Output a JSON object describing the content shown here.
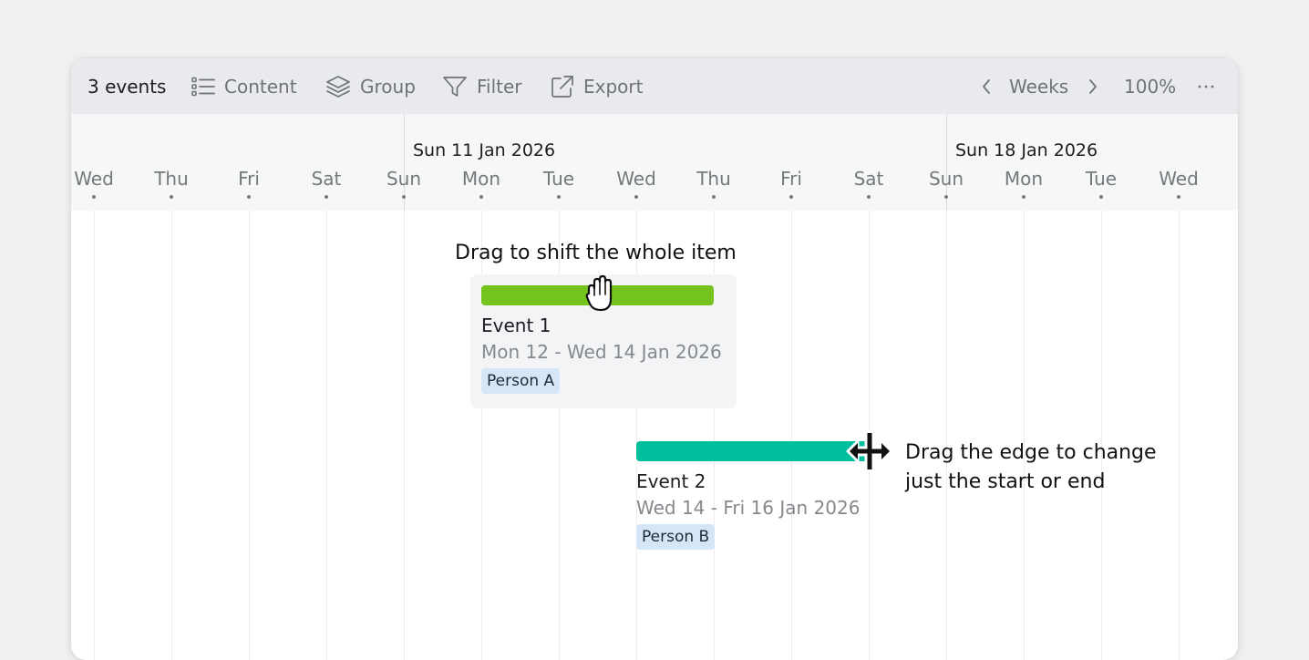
{
  "toolbar": {
    "event_count": "3 events",
    "content_label": "Content",
    "group_label": "Group",
    "filter_label": "Filter",
    "export_label": "Export",
    "scale_label": "Weeks",
    "zoom_label": "100%"
  },
  "timeline": {
    "week_labels": [
      "Sun 11 Jan 2026",
      "Sun 18 Jan 2026"
    ],
    "days": [
      "Wed",
      "Thu",
      "Fri",
      "Sat",
      "Sun",
      "Mon",
      "Tue",
      "Wed",
      "Thu",
      "Fri",
      "Sat",
      "Sun",
      "Mon",
      "Tue",
      "Wed"
    ]
  },
  "events": [
    {
      "title": "Event 1",
      "dates": "Mon 12 - Wed 14 Jan 2026",
      "person": "Person A",
      "color": "#74c41d"
    },
    {
      "title": "Event 2",
      "dates": "Wed 14 - Fri 16 Jan 2026",
      "person": "Person B",
      "color": "#00bf9c"
    }
  ],
  "hints": {
    "move": "Drag to shift the whole item",
    "resize_line1": "Drag the edge to change",
    "resize_line2": "just the start or end"
  },
  "icons": {
    "content": "list-icon",
    "group": "layers-icon",
    "filter": "filter-icon",
    "export": "external-link-icon",
    "prev": "chevron-left-icon",
    "next": "chevron-right-icon",
    "more": "ellipsis-icon",
    "move_cursor": "grab-hand-cursor-icon",
    "resize_cursor": "resize-horizontal-cursor-icon"
  }
}
